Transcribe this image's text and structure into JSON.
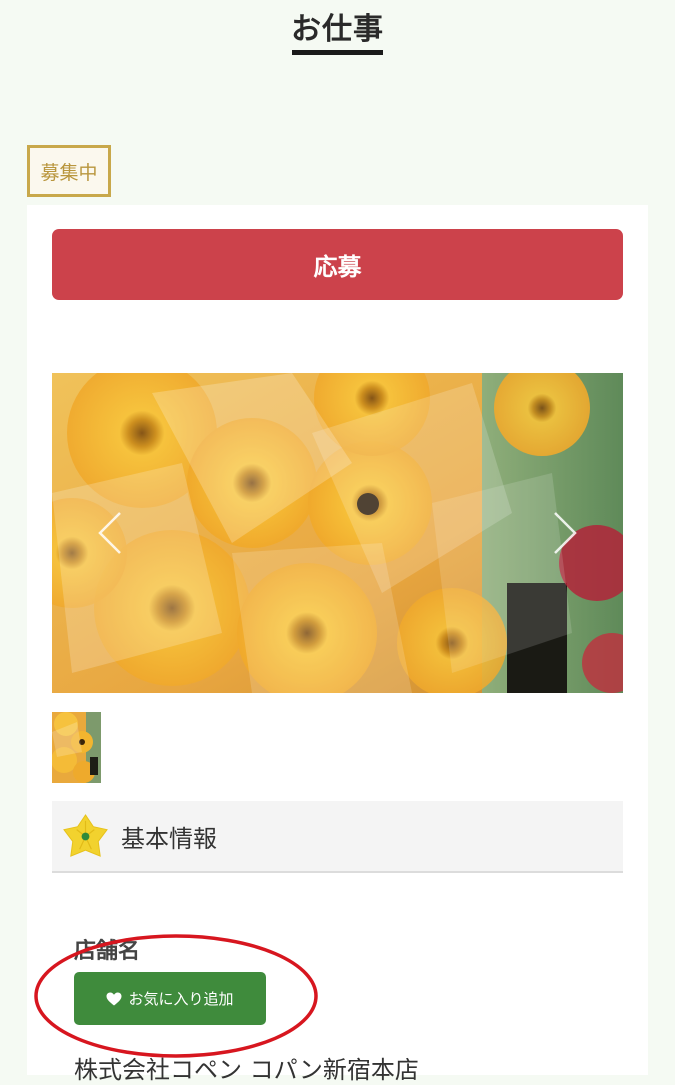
{
  "page": {
    "title": "お仕事"
  },
  "job": {
    "status_badge": "募集中",
    "apply_label": "応募"
  },
  "gallery": {
    "prev_icon": "chevron-left-icon",
    "next_icon": "chevron-right-icon",
    "thumbnail_count": 1
  },
  "basic_info": {
    "heading": "基本情報",
    "icon": "flower-icon",
    "shop_label": "店舗名",
    "favorite_label": "お気に入り追加",
    "favorite_icon": "heart-icon",
    "shop_name": "株式会社コペン コパン新宿本店"
  },
  "colors": {
    "apply": "#cc424b",
    "favorite": "#3f8b3c",
    "badge": "#c8a84b",
    "annotation": "#d7161f"
  }
}
